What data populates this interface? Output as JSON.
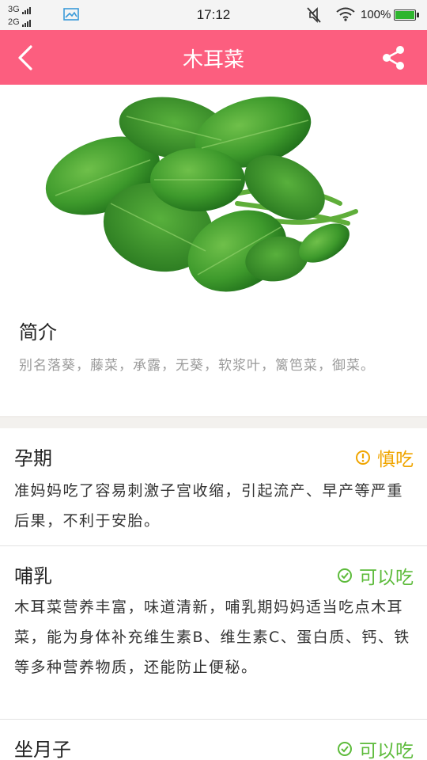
{
  "status_bar": {
    "network1": "3G",
    "network2": "2G",
    "time": "17:12",
    "battery_percent": "100%",
    "battery_level": 1.0
  },
  "header": {
    "title": "木耳菜"
  },
  "intro": {
    "heading": "简介",
    "text": "别名落葵，藤菜，承露，无葵，软浆叶，篱笆菜，御菜。"
  },
  "sections": [
    {
      "title": "孕期",
      "status": "慎吃",
      "status_icon": "warning-circle-icon",
      "status_color": "#f0a500",
      "text": "准妈妈吃了容易刺激子宫收缩，引起流产、早产等严重后果，不利于安胎。"
    },
    {
      "title": "哺乳",
      "status": "可以吃",
      "status_icon": "check-circle-icon",
      "status_color": "#5dbb3b",
      "text": "木耳菜营养丰富，味道清新，哺乳期妈妈适当吃点木耳菜，能为身体补充维生素B、维生素C、蛋白质、钙、铁等多种营养物质，还能防止便秘。"
    },
    {
      "title": "坐月子",
      "status": "可以吃",
      "status_icon": "check-circle-icon",
      "status_color": "#5dbb3b",
      "text": ""
    }
  ],
  "colors": {
    "header_bg": "#fc5e7f",
    "caution": "#f0a500",
    "ok": "#5dbb3b"
  }
}
